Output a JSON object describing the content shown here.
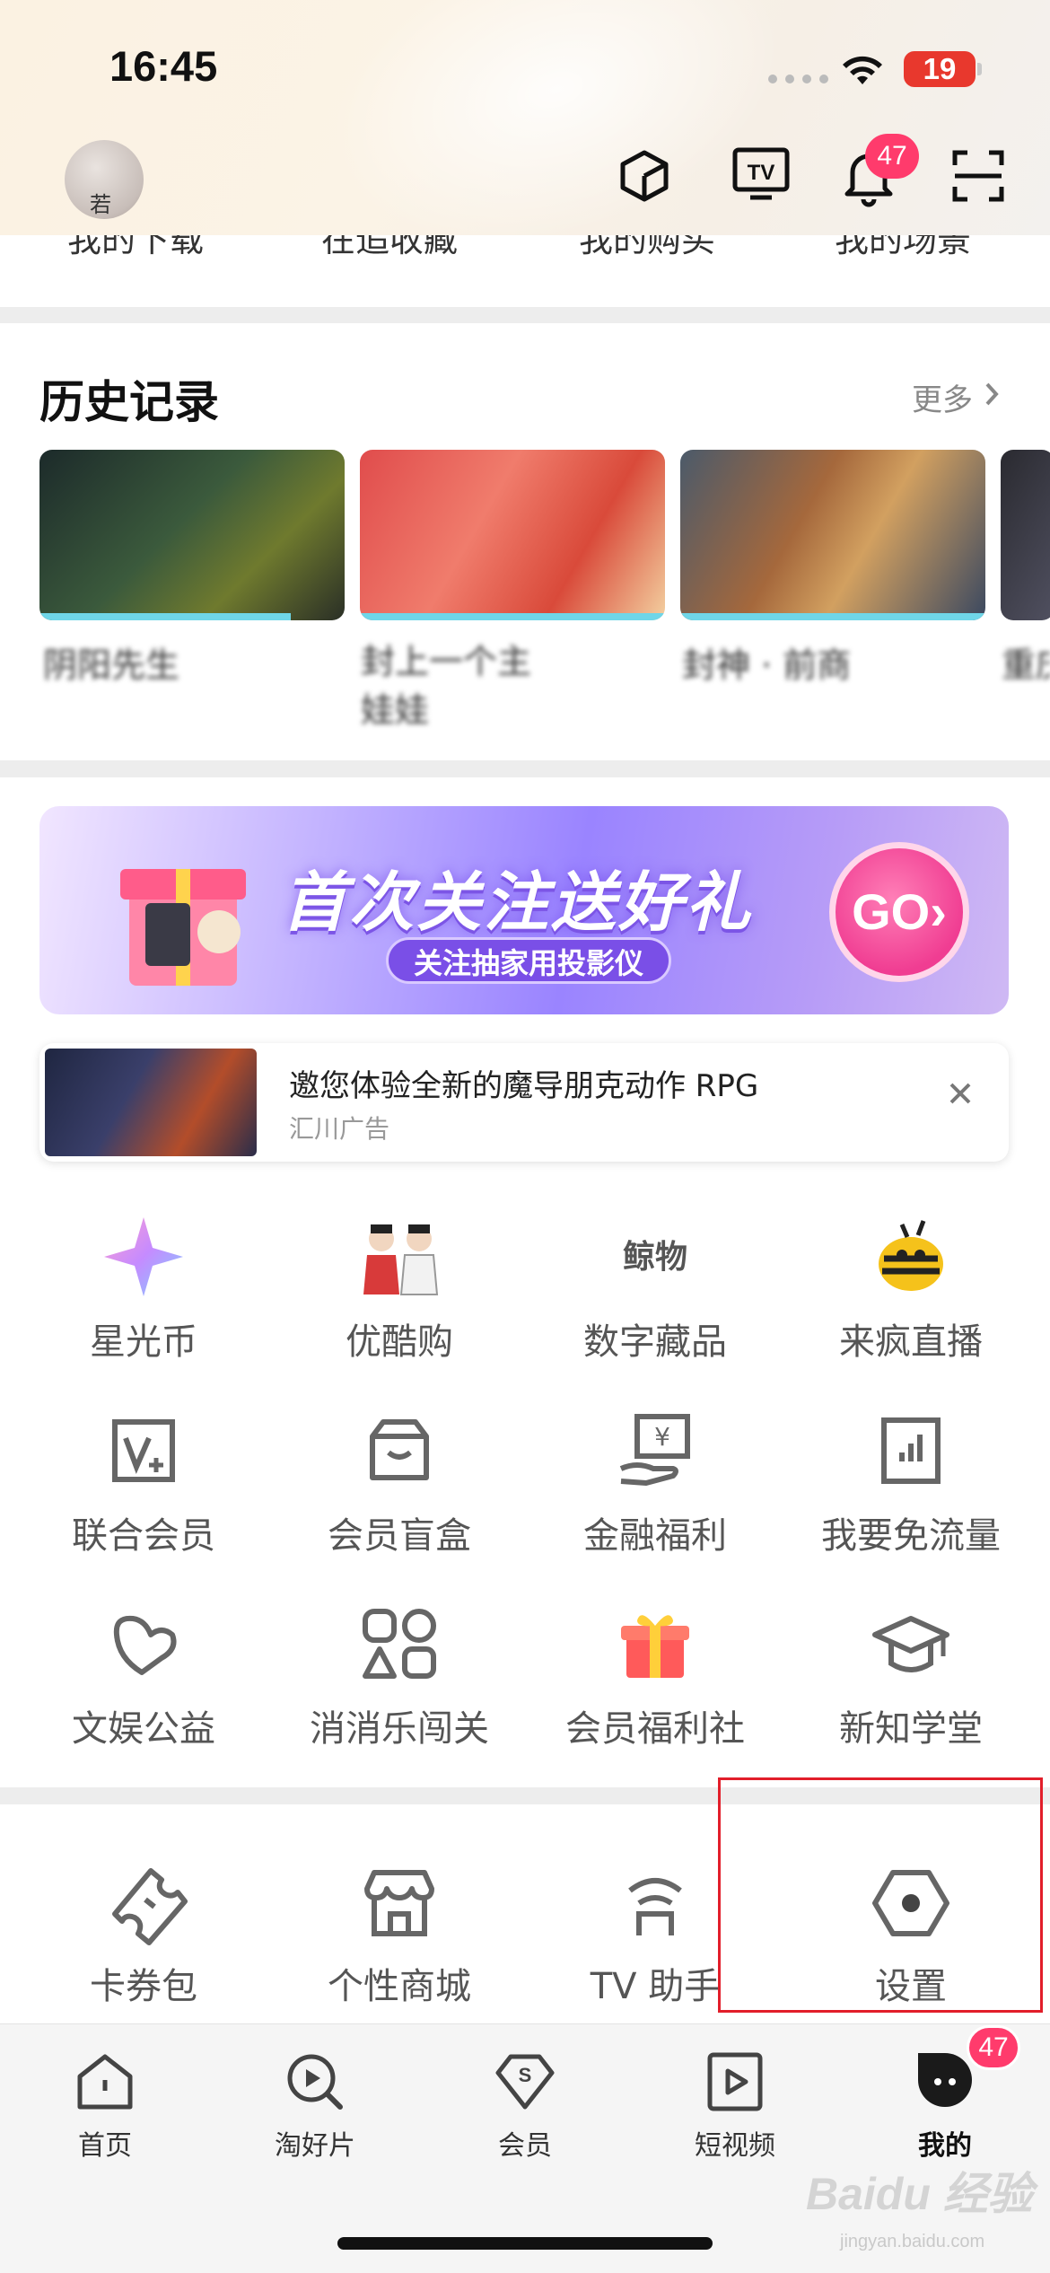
{
  "status_bar": {
    "time": "16:45",
    "battery": "19"
  },
  "header": {
    "avatar_text": "若",
    "notification_count": "47"
  },
  "quick_row": [
    "我的下载",
    "在追收藏",
    "我的购买",
    "我的场景"
  ],
  "history": {
    "title": "历史记录",
    "more": "更多",
    "items": [
      {
        "label": "阴阳先生"
      },
      {
        "label": "封上一个主 娃娃"
      },
      {
        "label": "封神 · 前商"
      },
      {
        "label": "重庆"
      }
    ]
  },
  "banner": {
    "title": "首次关注送好礼",
    "subtitle": "关注抽家用投影仪",
    "go": "GO›"
  },
  "ad": {
    "title": "邀您体验全新的魔导朋克动作 RPG",
    "source": "汇川广告"
  },
  "services": [
    {
      "label": "星光币",
      "icon": "starlight-coin-icon"
    },
    {
      "label": "优酷购",
      "icon": "youku-shop-icon"
    },
    {
      "label": "数字藏品",
      "icon": "digital-collectible-icon"
    },
    {
      "label": "来疯直播",
      "icon": "bee-live-icon"
    },
    {
      "label": "联合会员",
      "icon": "joint-vip-icon"
    },
    {
      "label": "会员盲盒",
      "icon": "blind-box-icon"
    },
    {
      "label": "金融福利",
      "icon": "finance-icon"
    },
    {
      "label": "我要免流量",
      "icon": "data-free-icon"
    },
    {
      "label": "文娱公益",
      "icon": "charity-icon"
    },
    {
      "label": "消消乐闯关",
      "icon": "match-game-icon"
    },
    {
      "label": "会员福利社",
      "icon": "gift-icon"
    },
    {
      "label": "新知学堂",
      "icon": "graduation-cap-icon"
    }
  ],
  "tools": [
    {
      "label": "卡券包",
      "icon": "ticket-icon"
    },
    {
      "label": "个性商城",
      "icon": "store-icon"
    },
    {
      "label": "TV 助手",
      "icon": "tv-assistant-icon"
    },
    {
      "label": "设置",
      "icon": "settings-hexagon-icon"
    }
  ],
  "tabs": [
    {
      "label": "首页",
      "icon": "home-icon"
    },
    {
      "label": "淘好片",
      "icon": "search-play-icon"
    },
    {
      "label": "会员",
      "icon": "vip-diamond-icon"
    },
    {
      "label": "短视频",
      "icon": "short-video-icon"
    },
    {
      "label": "我的",
      "icon": "profile-icon",
      "active": true
    }
  ],
  "tab_badge": "47",
  "watermark": {
    "brand": "Baidu 经验",
    "url": "jingyan.baidu.com"
  },
  "colors": {
    "accent_pink": "#ff3b6c",
    "highlight_red": "#e21e2a",
    "progress_cyan": "#6fd6e8"
  }
}
